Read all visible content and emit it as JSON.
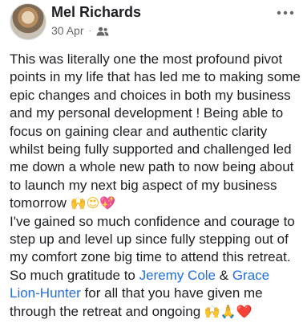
{
  "post": {
    "author": "Mel Richards",
    "date": "30 Apr",
    "separator": "·",
    "audience_icon": "friends-icon",
    "more_icon": "more-options-icon",
    "paragraphs": {
      "p1_text": "This was literally one the most profound pivot points in my life that has led me to making some epic changes and choices in both my business and my personal development ! Being able to focus on gaining clear and authentic clarity whilst being fully supported and challenged led me down a whole new path to now being about to launch my next big aspect of my business tomorrow ",
      "p1_emojis": [
        "🙌",
        "😍",
        "💖"
      ],
      "p2_text": "I've gained so much confidence and courage to step up and level up since fully stepping out of my comfort zone big time to attend this retreat.",
      "p3_prefix": "So much gratitude to ",
      "mention_1": "Jeremy Cole",
      "p3_and": " & ",
      "mention_2": "Grace Lion-Hunter",
      "p3_suffix": " for all that you have given me through the retreat and ongoing ",
      "p3_emojis": [
        "🙌",
        "🙏",
        "❤️"
      ]
    }
  }
}
